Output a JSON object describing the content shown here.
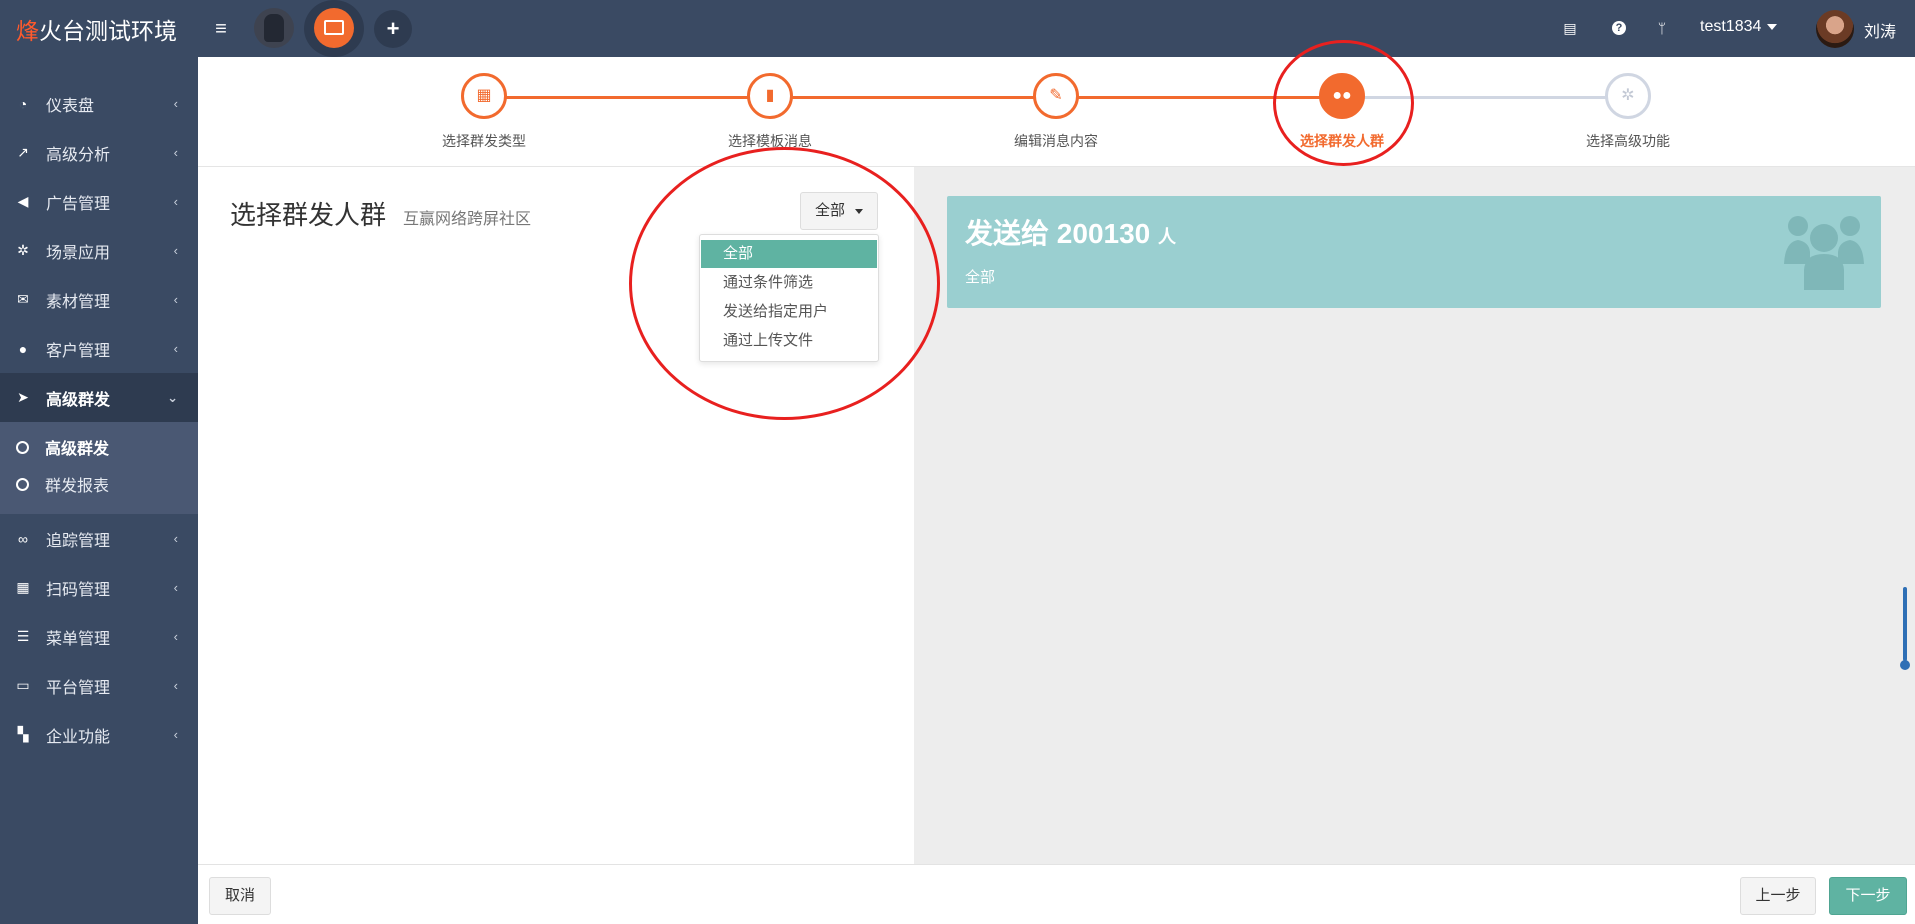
{
  "app": {
    "logo_accent": "烽",
    "logo_rest": "火台测试环境"
  },
  "topbar": {
    "menu_icon": "hamburger-icon",
    "apps": [
      "app-avatar-lock",
      "app-screen-share",
      "plus-icon"
    ],
    "right_icons": [
      "book-icon",
      "help-icon",
      "branch-icon"
    ],
    "user_select": "test1834",
    "user_name": "刘涛"
  },
  "sidebar": {
    "items": [
      {
        "label": "仪表盘",
        "icon": "dashboard-icon"
      },
      {
        "label": "高级分析",
        "icon": "line-chart-icon"
      },
      {
        "label": "广告管理",
        "icon": "bullhorn-icon"
      },
      {
        "label": "场景应用",
        "icon": "gear-icon"
      },
      {
        "label": "素材管理",
        "icon": "envelope-icon"
      },
      {
        "label": "客户管理",
        "icon": "user-icon"
      },
      {
        "label": "高级群发",
        "icon": "paper-plane-icon",
        "active": true
      },
      {
        "label": "追踪管理",
        "icon": "link-icon"
      },
      {
        "label": "扫码管理",
        "icon": "qrcode-icon"
      },
      {
        "label": "菜单管理",
        "icon": "list-icon"
      },
      {
        "label": "平台管理",
        "icon": "desktop-icon"
      },
      {
        "label": "企业功能",
        "icon": "grid-icon"
      }
    ],
    "submenu": [
      {
        "label": "高级群发",
        "active": true
      },
      {
        "label": "群发报表",
        "active": false
      }
    ]
  },
  "stepper": {
    "steps": [
      {
        "label": "选择群发类型",
        "state": "done",
        "icon": "grid-icon"
      },
      {
        "label": "选择模板消息",
        "state": "done",
        "icon": "file-icon"
      },
      {
        "label": "编辑消息内容",
        "state": "done",
        "icon": "edit-icon"
      },
      {
        "label": "选择群发人群",
        "state": "current",
        "icon": "users-icon"
      },
      {
        "label": "选择高级功能",
        "state": "todo",
        "icon": "gear-icon"
      }
    ]
  },
  "left": {
    "title": "选择群发人群",
    "subtitle": "互赢网络跨屏社区",
    "dropdown_value": "全部",
    "dropdown_options": [
      "全部",
      "通过条件筛选",
      "发送给指定用户",
      "通过上传文件"
    ],
    "selected_option": "全部"
  },
  "right": {
    "card_prefix": "发送给",
    "card_count": "200130",
    "card_unit": "人",
    "card_sub": "全部",
    "card_icon": "users-icon"
  },
  "footer": {
    "cancel": "取消",
    "prev": "上一步",
    "next": "下一步"
  },
  "colors": {
    "topbar": "#3a4a63",
    "accent": "#f26a2e",
    "teal": "#5fb3a2",
    "card": "#9acfd0",
    "annotation": "#e8201f"
  }
}
